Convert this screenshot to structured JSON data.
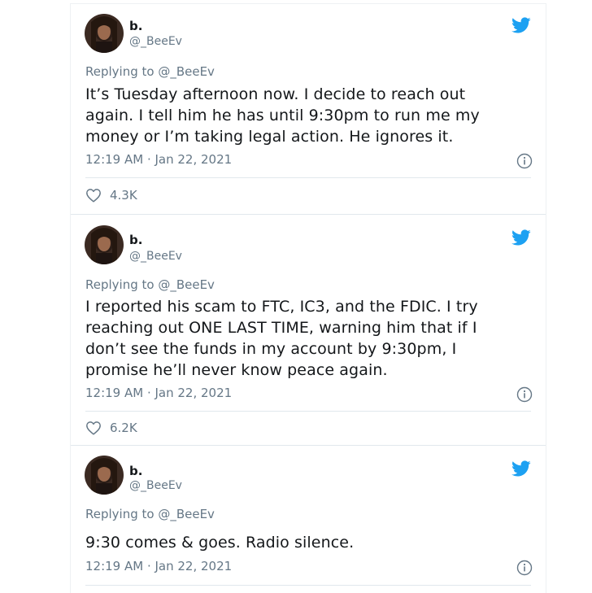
{
  "colors": {
    "twitter_blue": "#1da1f2",
    "secondary_text": "#657786",
    "primary_text": "#14171a"
  },
  "icons": {
    "brand": "twitter-bird-icon",
    "info": "info-icon",
    "like": "heart-icon"
  },
  "tweets": [
    {
      "name": "b.",
      "handle": "@_BeeEv",
      "replying_to": "Replying to @_BeeEv",
      "lines": [
        "It’s Tuesday afternoon now. I decide to reach out",
        "again. I tell him he has until 9:30pm to run me my",
        "money or I’m taking legal action. He ignores it."
      ],
      "timestamp": "12:19 AM · Jan 22, 2021",
      "likes": "4.3K"
    },
    {
      "name": "b.",
      "handle": "@_BeeEv",
      "replying_to": "Replying to @_BeeEv",
      "lines": [
        "I reported his scam to FTC, IC3, and the FDIC. I try",
        "reaching out ONE LAST TIME, warning him that if I",
        "don’t see the funds in my account by 9:30pm, I",
        "promise he’ll never know peace again."
      ],
      "timestamp": "12:19 AM · Jan 22, 2021",
      "likes": "6.2K"
    },
    {
      "name": "b.",
      "handle": "@_BeeEv",
      "replying_to": "Replying to @_BeeEv",
      "lines": [
        "9:30 comes & goes. Radio silence."
      ],
      "timestamp": "12:19 AM · Jan 22, 2021"
    }
  ]
}
